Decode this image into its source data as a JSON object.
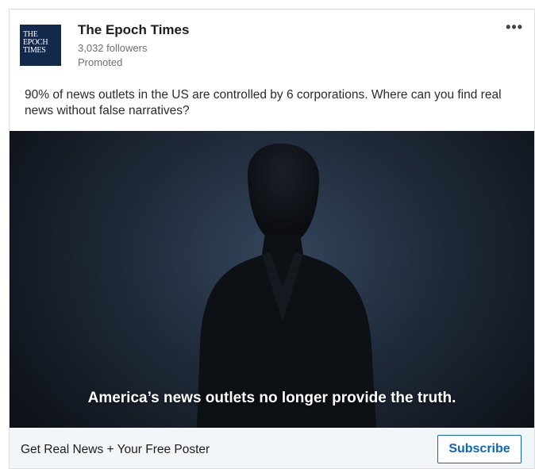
{
  "advertiser": {
    "logo_lines": [
      "THE",
      "EPOCH",
      "TIMES"
    ],
    "name": "The Epoch Times",
    "followers": "3,032 followers",
    "sponsored_label": "Promoted"
  },
  "menu": {
    "icon": "more-horizontal-icon",
    "glyph": "•••"
  },
  "post": {
    "text": "90% of news outlets in the US are controlled by 6 corporations. Where can you find real news without false narratives?"
  },
  "media": {
    "caption": "America’s news outlets no longer provide the truth."
  },
  "footer": {
    "headline": "Get Real News + Your Free Poster",
    "button_label": "Subscribe"
  },
  "colors": {
    "brand_navy": "#13294b",
    "button_blue": "#0a66c2",
    "footer_bg": "#f3f6f8"
  }
}
